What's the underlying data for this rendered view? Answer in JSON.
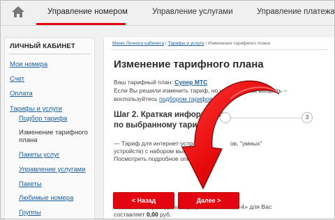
{
  "nav": {
    "home_icon": "home-icon",
    "tabs": [
      "Управление номером",
      "Управление услугами",
      "Управление платежами"
    ],
    "accent": "#e30611"
  },
  "sidebar": {
    "title": "ЛИЧНЫЙ КАБИНЕТ",
    "items": [
      "Мои номера",
      "Счет",
      "Оплата",
      "Тарифы и услуги",
      "Подбор тарифа",
      "Изменение тарифного плана",
      "Пакеты услуг",
      "Управление услугами",
      "Пакеты",
      "Любимые номера",
      "Группы"
    ]
  },
  "breadcrumb": {
    "items": [
      "Меню Личного кабинета",
      "Тарифы и услуги",
      "Изменение тарифного плана"
    ],
    "separator": "/"
  },
  "main": {
    "title": "Изменение тарифного плана",
    "current_plan_label": "Ваш тарифный план:",
    "current_plan_name": "Супер МТС",
    "hint_line1": "Если Вы решили изменить тариф, но не знаете как выбрать –",
    "hint_line2_prefix": "воспользуйтесь",
    "hint_line2_link": "подбором тарифов",
    "step_title_line1": "Шаг 2. Краткая информация",
    "step_title_line2": "по выбранному тарифу",
    "step_last": "3",
    "desc_line1_a": "— Тариф для интернет-устрой",
    "desc_line1_b": "ов, \"умных\"",
    "desc_line2_a": "устройств) с набором выгодн",
    "desc_line3": "Посмотреть подробное описан",
    "cost_line1_a": "Стоимость перехода на тариф",
    "cost_line1_b": "нет-4» для Вас",
    "cost_line2_prefix": "составляет",
    "cost_value": "0,00",
    "cost_unit": "руб.",
    "back_button": "< Назад",
    "next_button": "Далее >"
  }
}
